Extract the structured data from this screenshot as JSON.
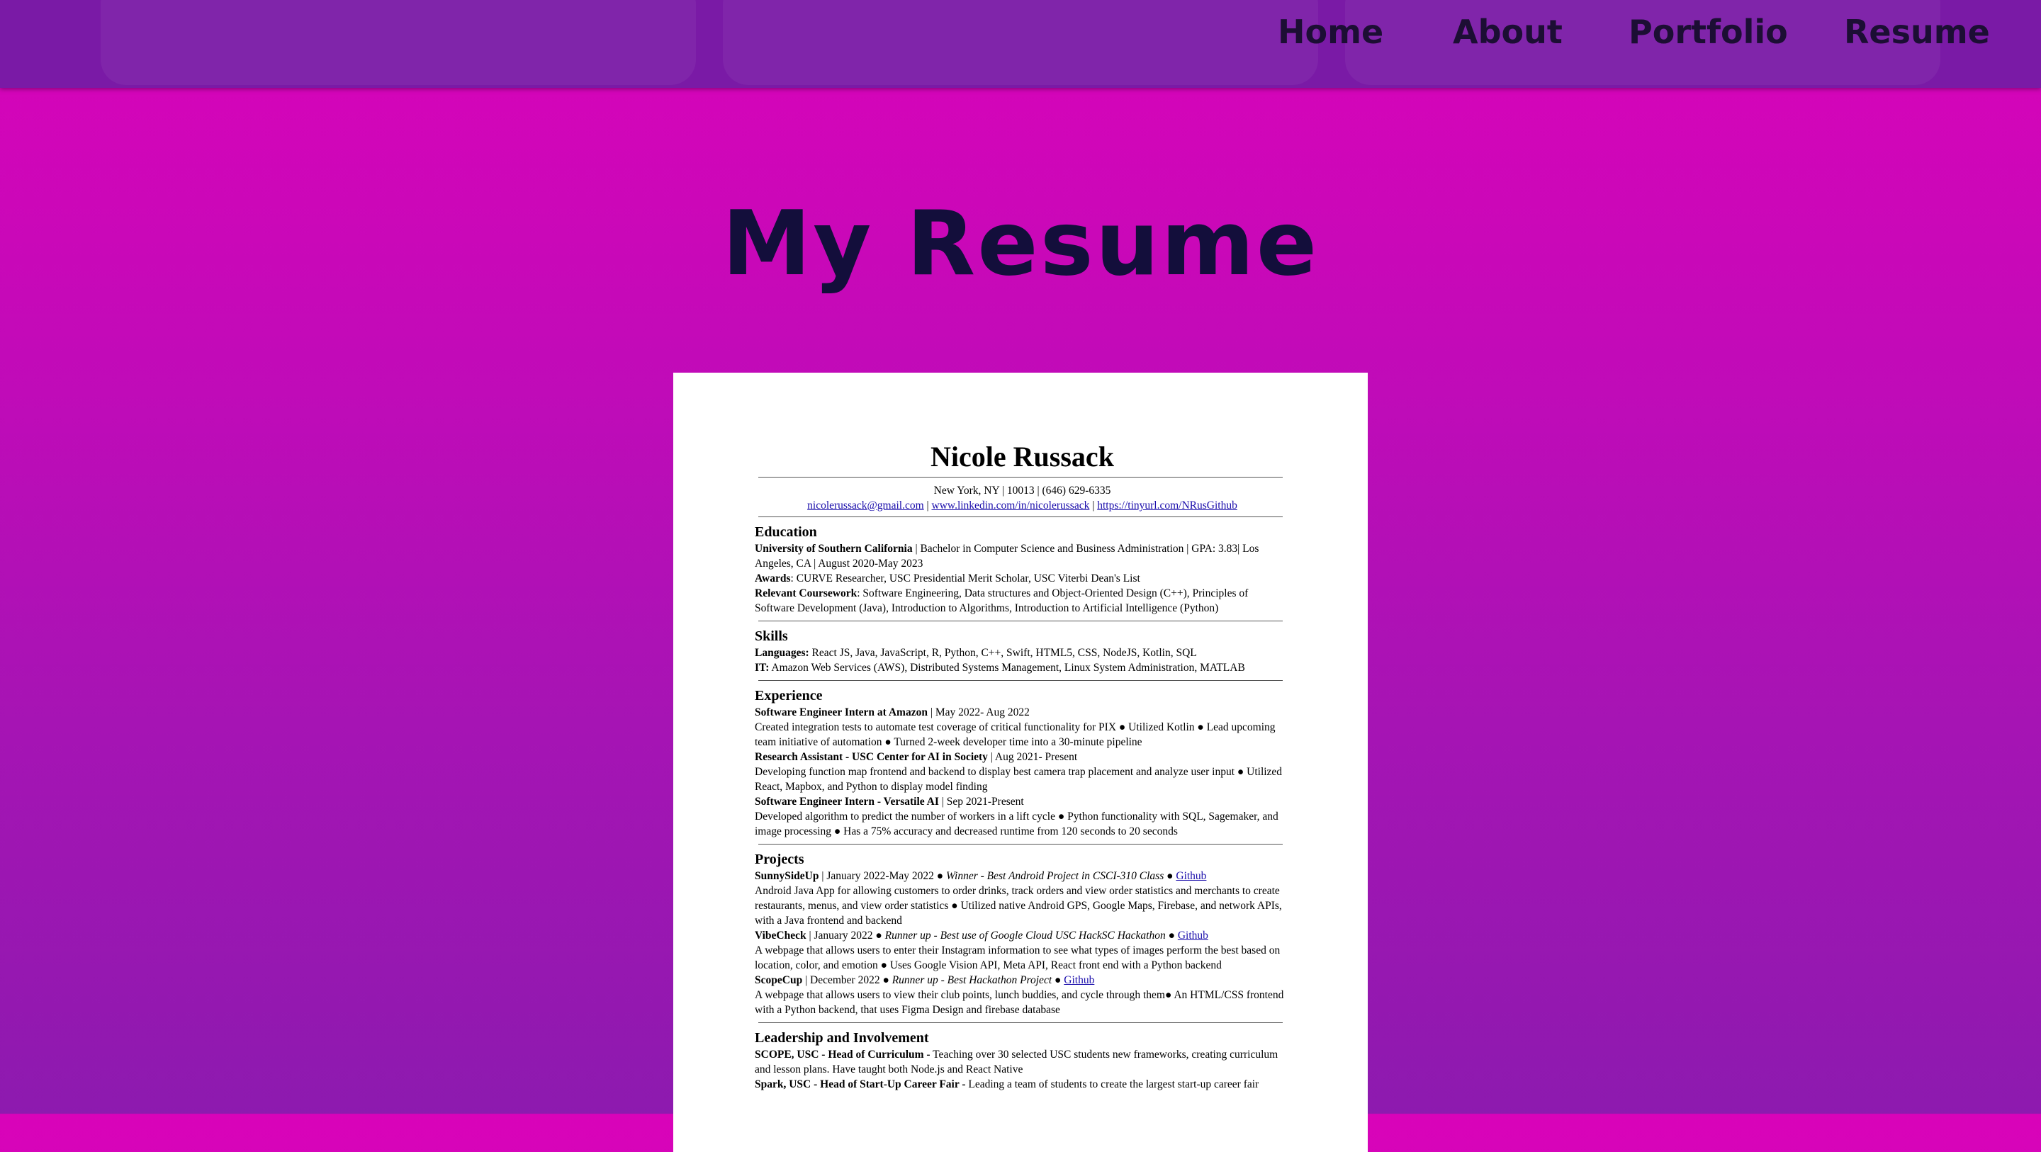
{
  "nav": {
    "links": [
      {
        "label": "Home"
      },
      {
        "label": "About"
      },
      {
        "label": "Portfolio"
      },
      {
        "label": "Resume"
      }
    ]
  },
  "page": {
    "title": "My Resume"
  },
  "resume": {
    "name": "Nicole Russack",
    "contact_line": "New York, NY | 10013 | (646) 629-6335",
    "email": "nicolerussack@gmail.com",
    "linkedin": "www.linkedin.com/in/nicolerussack",
    "github": "https://tinyurl.com/NRusGithub",
    "sep": " | ",
    "education": {
      "title": "Education",
      "school": "University of Southern California",
      "school_detail": " | Bachelor in Computer Science and Business Administration | GPA: 3.83| Los Angeles, CA | August 2020-May 2023",
      "awards_label": "Awards",
      "awards": ": CURVE Researcher, USC Presidential Merit Scholar, USC Viterbi Dean's List",
      "coursework_label": "Relevant Coursework",
      "coursework": ": Software Engineering, Data structures and Object-Oriented Design (C++), Principles of Software Development (Java), Introduction to Algorithms, Introduction to Artificial Intelligence (Python)"
    },
    "skills": {
      "title": "Skills",
      "languages_label": "Languages:",
      "languages": " React JS, Java, JavaScript, R, Python, C++, Swift, HTML5, CSS, NodeJS, Kotlin, SQL",
      "it_label": "IT:",
      "it": " Amazon Web Services (AWS), Distributed Systems Management, Linux System Administration, MATLAB"
    },
    "experience": {
      "title": "Experience",
      "jobs": [
        {
          "role": "Software Engineer Intern at Amazon",
          "dates": " | May 2022- Aug 2022",
          "desc": "Created integration tests to automate test coverage of critical functionality for PIX  ● Utilized Kotlin ● Lead upcoming team initiative of automation ● Turned 2-week developer time into a 30-minute pipeline"
        },
        {
          "role": "Research Assistant - USC Center for AI in Society",
          "dates": " | Aug 2021- Present",
          "desc": "Developing function map frontend and backend to display best camera trap placement and analyze user input ● Utilized React, Mapbox, and Python to display model finding"
        },
        {
          "role": "Software Engineer Intern - Versatile AI",
          "dates": " | Sep 2021-Present",
          "desc": "Developed algorithm to predict the number of workers in a lift cycle ● Python functionality with SQL, Sagemaker, and image processing ● Has a 75% accuracy and decreased runtime from 120 seconds to 20 seconds"
        }
      ]
    },
    "projects": {
      "title": "Projects",
      "items": [
        {
          "name": "SunnySideUp",
          "dates": " | January 2022-May 2022 ● ",
          "award": "Winner - Best Android Project in CSCI-310 Class",
          "bullet": " ● ",
          "link": "Github",
          "desc": "Android Java App for allowing customers to order drinks, track orders and view order statistics and merchants to create restaurants, menus, and view order statistics ● Utilized native Android GPS, Google Maps, Firebase, and network APIs, with a Java frontend and backend"
        },
        {
          "name": "VibeCheck",
          "dates": " | January 2022 ● ",
          "award": "Runner up - Best use of Google Cloud USC HackSC Hackathon",
          "bullet": " ● ",
          "link": "Github",
          "desc": "A webpage that allows users to enter their Instagram information to see what types of images perform the best based on location, color, and emotion ● Uses Google Vision API, Meta API, React front end with a Python backend"
        },
        {
          "name": "ScopeCup",
          "dates": " | December 2022 ● ",
          "award": "Runner up - Best Hackathon Project",
          "bullet": " ● ",
          "link": "Github",
          "desc": "A webpage that allows users to view their club points, lunch buddies, and cycle through them● An HTML/CSS frontend with a Python backend, that uses Figma Design and firebase database"
        }
      ]
    },
    "leadership": {
      "title": "Leadership and Involvement",
      "items": [
        {
          "role": "SCOPE, USC - Head of Curriculum -",
          "desc": " Teaching over 30 selected USC students new frameworks, creating curriculum and lesson plans. Have taught both Node.js and React Native"
        },
        {
          "role": "Spark, USC - Head of Start-Up Career Fair -",
          "desc": " Leading a team of students to create the largest start-up career fair"
        }
      ]
    }
  }
}
